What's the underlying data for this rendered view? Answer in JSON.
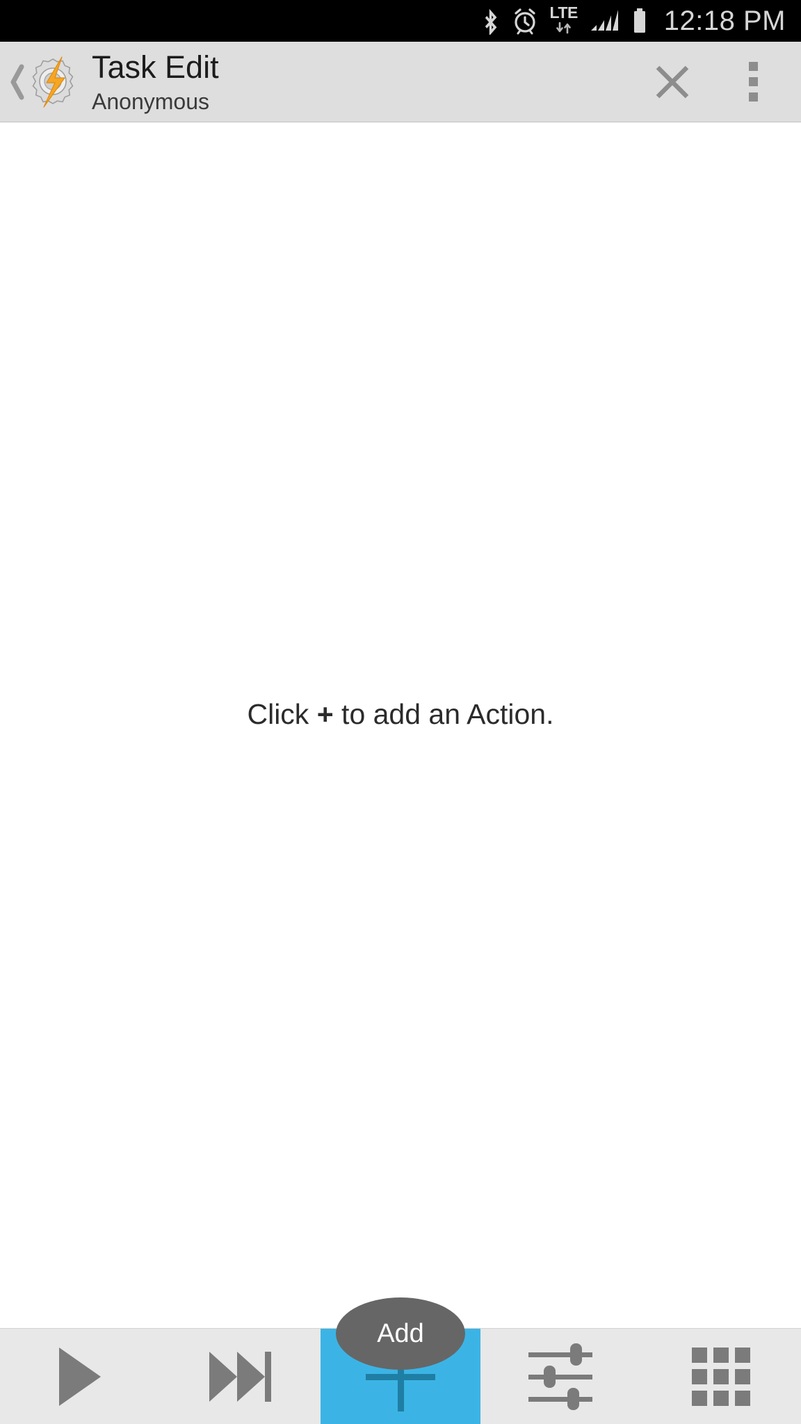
{
  "status_bar": {
    "icons": [
      "bluetooth-icon",
      "alarm-clock-icon",
      "lte-icon",
      "signal-bars-icon",
      "battery-icon"
    ],
    "lte_label": "LTE",
    "time": "12:18 PM",
    "background": "#000000",
    "foreground": "#d6d6d6"
  },
  "header": {
    "back_label": "‹",
    "logo": "tasker-gear-bolt-icon",
    "title": "Task Edit",
    "subtitle": "Anonymous",
    "close_label": "✕",
    "overflow_label": "more-options",
    "background": "#dedede"
  },
  "content": {
    "hint_prefix": "Click ",
    "hint_symbol": "+",
    "hint_suffix": " to add an Action."
  },
  "tooltip": {
    "label": "Add",
    "background": "#666666"
  },
  "toolbar": {
    "background": "#e8e8e8",
    "active_color": "#3bb4e5",
    "icon_color": "#7b7b7b",
    "buttons": [
      {
        "name": "play-button",
        "icon": "play-icon",
        "label": "Play"
      },
      {
        "name": "step-button",
        "icon": "skip-next-icon",
        "label": "Step"
      },
      {
        "name": "add-action-button",
        "icon": "plus-icon",
        "label": "Add",
        "active": true
      },
      {
        "name": "properties-button",
        "icon": "sliders-icon",
        "label": "Properties"
      },
      {
        "name": "menu-grid-button",
        "icon": "grid-icon",
        "label": "Menu"
      }
    ]
  }
}
